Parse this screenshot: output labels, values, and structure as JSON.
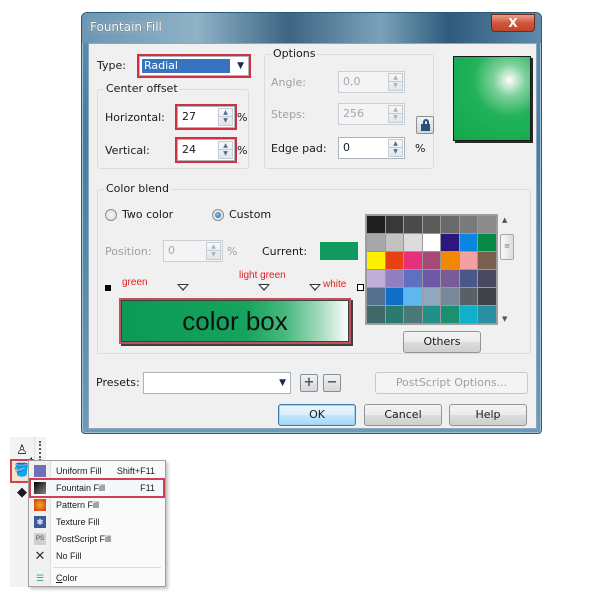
{
  "dialog": {
    "title": "Fountain Fill",
    "close_label": "X",
    "type": {
      "label": "Type:",
      "selected": "Radial"
    },
    "center_offset": {
      "group_label": "Center offset",
      "horizontal": {
        "label": "Horizontal:",
        "value": "27",
        "unit": "%"
      },
      "vertical": {
        "label": "Vertical:",
        "value": "24",
        "unit": "%"
      }
    },
    "options": {
      "group_label": "Options",
      "angle": {
        "label": "Angle:",
        "value": "0,0"
      },
      "steps": {
        "label": "Steps:",
        "value": "256"
      },
      "edge_pad": {
        "label": "Edge pad:",
        "value": "0",
        "unit": "%"
      }
    },
    "preview": {
      "colors": {
        "base": "#10a84c",
        "highlight": "#ffffff"
      }
    },
    "color_blend": {
      "group_label": "Color blend",
      "two_color_label": "Two color",
      "custom_label": "Custom",
      "selected_mode": "Custom",
      "position": {
        "label": "Position:",
        "value": "0",
        "unit": "%"
      },
      "current_label": "Current:",
      "current_color": "#0f9b60",
      "annotations": {
        "green": "green",
        "light_green": "light green",
        "white": "white"
      },
      "color_box_label": "color box",
      "palette": [
        "#1f1f1f",
        "#383838",
        "#4a4a4a",
        "#5a5a5a",
        "#6a6a6a",
        "#7a7a7a",
        "#8c8c8c",
        "#a8a8a8",
        "#c2c2c2",
        "#dcdcdc",
        "#ffffff",
        "#2e1580",
        "#0a86e0",
        "#058a45",
        "#fff000",
        "#e84010",
        "#e8307a",
        "#a84a78",
        "#f08800",
        "#f4a0a0",
        "#786050",
        "#c0b0d8",
        "#9080c0",
        "#6070c0",
        "#7058a8",
        "#785c98",
        "#485888",
        "#4a4860",
        "#587090",
        "#1070c8",
        "#60b8f0",
        "#90a8c0",
        "#788898",
        "#5a6068",
        "#404448",
        "#406868",
        "#2a7a70",
        "#4a7878",
        "#209088",
        "#1a9070",
        "#10b0c8",
        "#2890a0"
      ],
      "others_label": "Others"
    },
    "presets": {
      "label": "Presets:",
      "value": ""
    },
    "postscript_label": "PostScript Options...",
    "add_preset_label": "+",
    "remove_preset_label": "−",
    "ok_label": "OK",
    "cancel_label": "Cancel",
    "help_label": "Help"
  },
  "flyout": {
    "items": [
      {
        "label": "Uniform Fill",
        "shortcut": "Shift+F11",
        "icon": "uniform-fill-icon"
      },
      {
        "label": "Fountain Fill",
        "shortcut": "F11",
        "icon": "fountain-fill-icon"
      },
      {
        "label": "Pattern Fill",
        "shortcut": "",
        "icon": "pattern-fill-icon"
      },
      {
        "label": "Texture Fill",
        "shortcut": "",
        "icon": "texture-fill-icon"
      },
      {
        "label": "PostScript Fill",
        "shortcut": "",
        "icon": "postscript-fill-icon"
      },
      {
        "label": "No Fill",
        "shortcut": "",
        "icon": "no-fill-icon"
      },
      {
        "label": "Color",
        "shortcut": "",
        "icon": "color-icon"
      }
    ]
  }
}
